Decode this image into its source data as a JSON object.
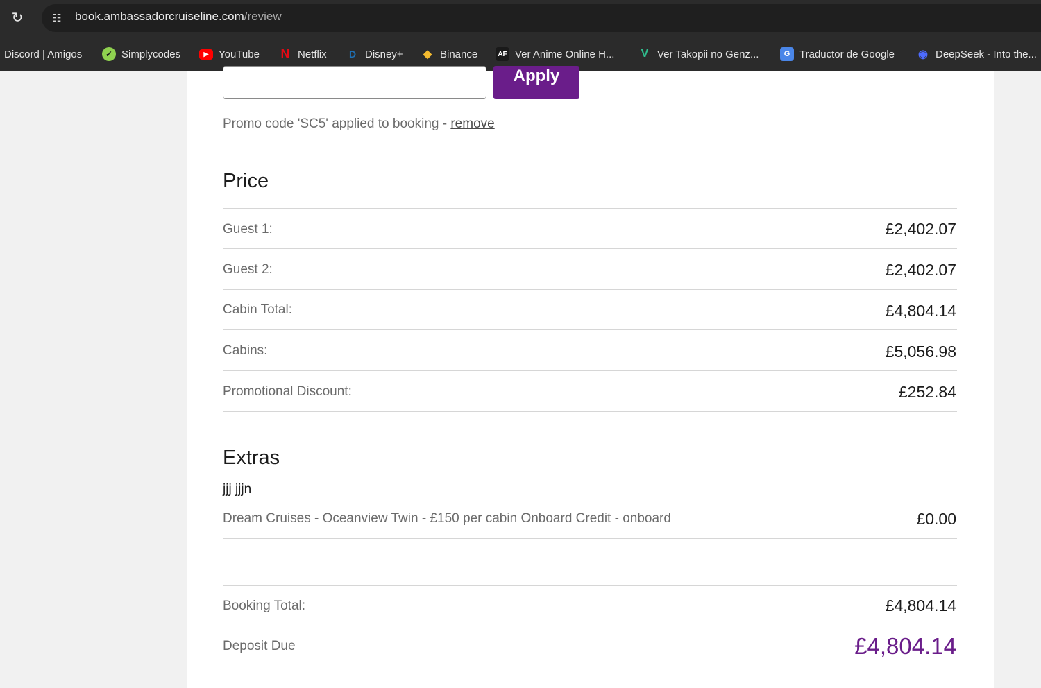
{
  "browser": {
    "url_host": "book.ambassadorcruiseline.com",
    "url_path": "/review",
    "bookmarks": [
      {
        "label": "Discord | Amigos",
        "icon": "discord-icon"
      },
      {
        "label": "Simplycodes",
        "icon": "simplycodes-icon",
        "color": "#8fd14f"
      },
      {
        "label": "YouTube",
        "icon": "youtube-icon",
        "color": "#ff0000"
      },
      {
        "label": "Netflix",
        "icon": "netflix-icon",
        "color": "#e50914"
      },
      {
        "label": "Disney+",
        "icon": "disney-plus-icon",
        "color": "#1f6fb2"
      },
      {
        "label": "Binance",
        "icon": "binance-icon",
        "color": "#f3ba2f"
      },
      {
        "label": "Ver Anime Online H...",
        "icon": "animeflv-icon"
      },
      {
        "label": "Ver Takopii no Genz...",
        "icon": "takopii-icon",
        "color": "#2fbf8f"
      },
      {
        "label": "Traductor de Google",
        "icon": "google-translate-icon",
        "color": "#4a86e8"
      },
      {
        "label": "DeepSeek - Into the...",
        "icon": "deepseek-icon",
        "color": "#4d6bfe"
      }
    ]
  },
  "promo": {
    "apply_label": "Apply",
    "note_prefix": "Promo code 'SC5' applied to booking - ",
    "remove_label": "remove"
  },
  "price": {
    "title": "Price",
    "rows": [
      {
        "label": "Guest 1:",
        "value": "£2,402.07"
      },
      {
        "label": "Guest 2:",
        "value": "£2,402.07"
      },
      {
        "label": "Cabin Total:",
        "value": "£4,804.14"
      },
      {
        "label": "Cabins:",
        "value": "£5,056.98"
      },
      {
        "label": "Promotional Discount:",
        "value": "£252.84"
      }
    ]
  },
  "extras": {
    "title": "Extras",
    "guest_name": "jjj jjjn",
    "item_label": "Dream Cruises - Oceanview Twin - £150 per cabin Onboard Credit - onboard",
    "item_value": "£0.00"
  },
  "totals": {
    "booking_total_label": "Booking Total:",
    "booking_total_value": "£4,804.14",
    "deposit_label": "Deposit Due",
    "deposit_value": "£4,804.14"
  },
  "colors": {
    "brand": "#6a1d8a"
  }
}
